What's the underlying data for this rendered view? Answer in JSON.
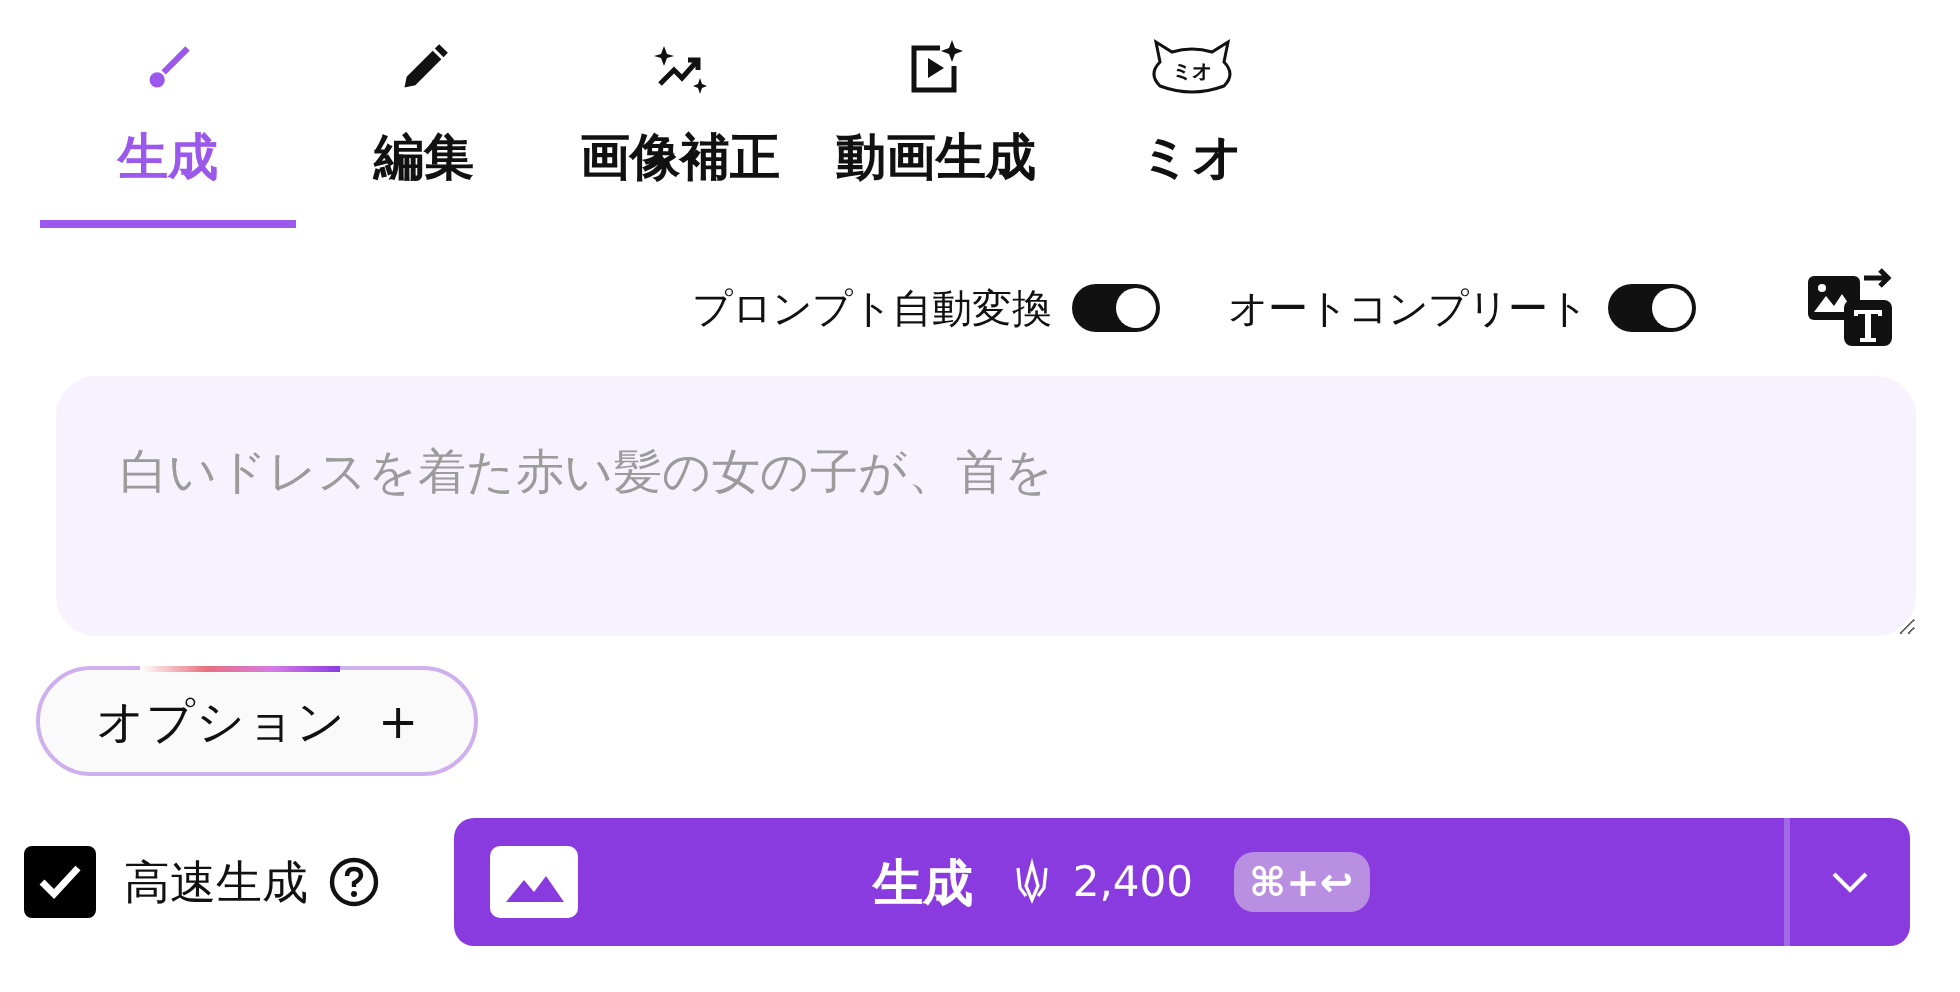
{
  "tabs": [
    {
      "label": "生成",
      "kind": "brush",
      "selected": true
    },
    {
      "label": "編集",
      "kind": "pencil",
      "selected": false
    },
    {
      "label": "画像補正",
      "kind": "enhance",
      "selected": false
    },
    {
      "label": "動画生成",
      "kind": "video",
      "selected": false
    },
    {
      "label": "ミオ",
      "kind": "cat",
      "icon_text": "ミオ",
      "selected": false
    }
  ],
  "toggles": [
    {
      "label": "プロンプト自動変換",
      "on": true
    },
    {
      "label": "オートコンプリート",
      "on": true
    }
  ],
  "prompt": {
    "placeholder": "白いドレスを着た赤い髪の女の子が、首を"
  },
  "options_button": {
    "label": "オプション",
    "icon_text": "+"
  },
  "fast_mode": {
    "label": "高速生成",
    "checked": true
  },
  "generate_button": {
    "label": "生成",
    "credits": "2,400",
    "shortcut": "⌘+↩"
  }
}
